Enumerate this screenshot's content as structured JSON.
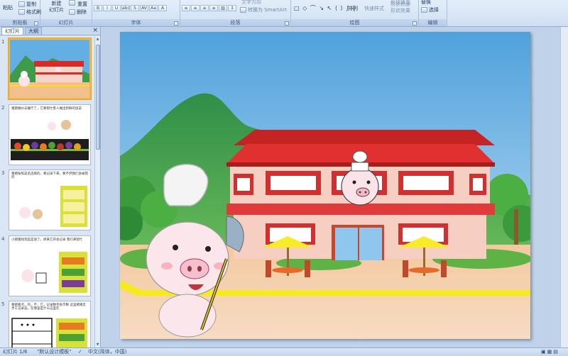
{
  "ribbon": {
    "clipboard": {
      "paste": "粘贴",
      "copy": "复制",
      "format_painter": "格式刷",
      "group": "剪贴板"
    },
    "slides": {
      "new_slide": "新建\n幻灯片",
      "layout": "版式",
      "reset": "重置",
      "delete": "删除",
      "group": "幻灯片"
    },
    "font": {
      "group": "字体"
    },
    "paragraph": {
      "text_direction": "文字方向",
      "align_text": "对齐文本",
      "smartart": "转换为 SmartArt",
      "group": "段落"
    },
    "drawing": {
      "arrange": "排列",
      "quick_styles": "快速样式",
      "shape_fill": "形状填充",
      "shape_outline": "形状轮廓",
      "shape_effects": "形状效果",
      "group": "绘图"
    },
    "editing": {
      "find": "查找",
      "replace": "替换",
      "select": "选择",
      "group": "编辑"
    }
  },
  "pane": {
    "tab_slides": "幻灯片",
    "tab_outline": "大纲",
    "close": "×",
    "thumbnails": [
      {
        "num": "1",
        "caption": ""
      },
      {
        "num": "2",
        "caption": "猪猪做炒去餐厅了，它要帮忙客人做出新鲜的饭菜"
      },
      {
        "num": "3",
        "caption": "猪猪按照菜名选择的，要记录下来，要不然我们会被错的"
      },
      {
        "num": "4",
        "caption": "小猪猪找到菜是放了，原来它开会记录 我们来帮忙"
      },
      {
        "num": "5",
        "caption": "猪猪看点，的，不，它，记录数字表示数 这里猪猪走手工记录菜，在哪里是什么这里在"
      }
    ]
  },
  "status": {
    "slide_info": "幻灯片 1/6",
    "theme": "\"默认设计模板\"",
    "language": "中文(简体，中国)"
  },
  "colors": {
    "accent": "#f4b740",
    "roof": "#d92a2a",
    "sky": "#5fa9dd"
  }
}
